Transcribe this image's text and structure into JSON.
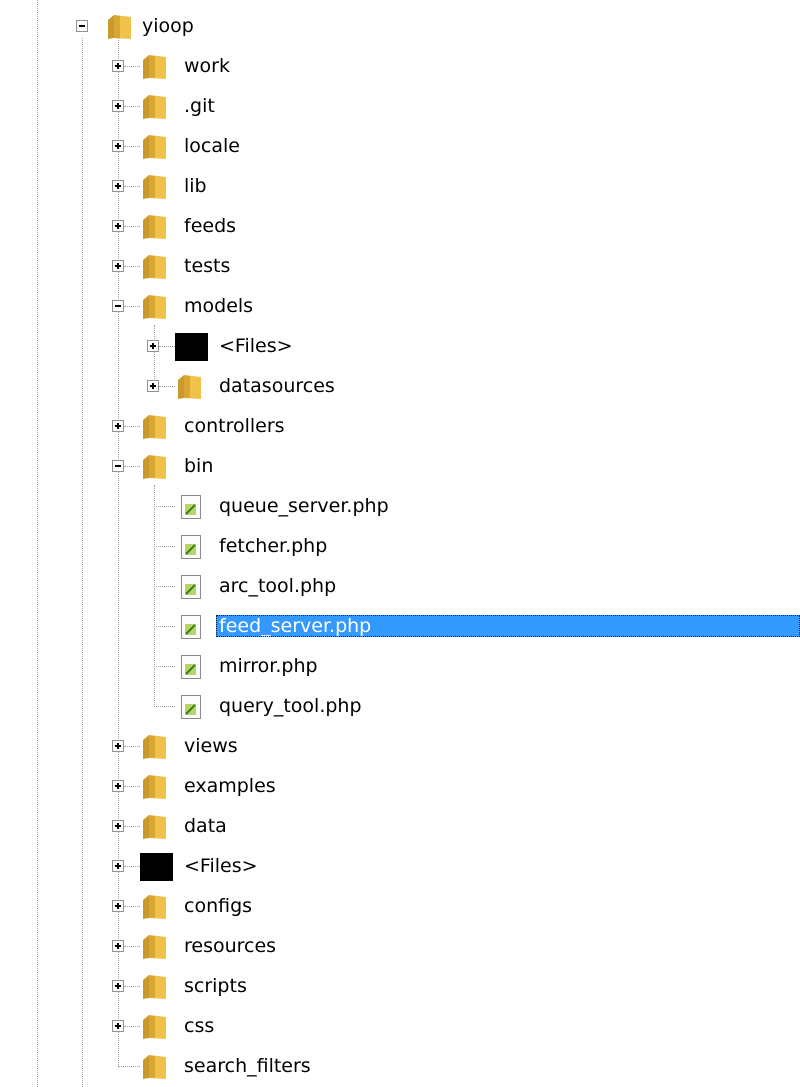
{
  "tree": {
    "root": {
      "label": "yioop",
      "expanded": true
    },
    "colors": {
      "selection": "#3399ff",
      "folder": "#e8b339"
    },
    "items": [
      {
        "label": "work",
        "type": "folder",
        "expander": "plus"
      },
      {
        "label": ".git",
        "type": "folder",
        "expander": "plus"
      },
      {
        "label": "locale",
        "type": "folder",
        "expander": "plus"
      },
      {
        "label": "lib",
        "type": "folder",
        "expander": "plus"
      },
      {
        "label": "feeds",
        "type": "folder",
        "expander": "plus"
      },
      {
        "label": "tests",
        "type": "folder",
        "expander": "plus"
      },
      {
        "label": "models",
        "type": "folder",
        "expander": "minus",
        "children": [
          {
            "label": "<Files>",
            "type": "files-group",
            "expander": "plus"
          },
          {
            "label": "datasources",
            "type": "folder",
            "expander": "plus"
          }
        ]
      },
      {
        "label": "controllers",
        "type": "folder",
        "expander": "plus"
      },
      {
        "label": "bin",
        "type": "folder",
        "expander": "minus",
        "children": [
          {
            "label": "queue_server.php",
            "type": "file"
          },
          {
            "label": "fetcher.php",
            "type": "file"
          },
          {
            "label": "arc_tool.php",
            "type": "file"
          },
          {
            "label": "feed_server.php",
            "type": "file",
            "selected": true
          },
          {
            "label": "mirror.php",
            "type": "file"
          },
          {
            "label": "query_tool.php",
            "type": "file"
          }
        ]
      },
      {
        "label": "views",
        "type": "folder",
        "expander": "plus"
      },
      {
        "label": "examples",
        "type": "folder",
        "expander": "plus"
      },
      {
        "label": "data",
        "type": "folder",
        "expander": "plus"
      },
      {
        "label": "<Files>",
        "type": "files-group",
        "expander": "plus"
      },
      {
        "label": "configs",
        "type": "folder",
        "expander": "plus"
      },
      {
        "label": "resources",
        "type": "folder",
        "expander": "plus"
      },
      {
        "label": "scripts",
        "type": "folder",
        "expander": "plus"
      },
      {
        "label": "css",
        "type": "folder",
        "expander": "plus"
      },
      {
        "label": "search_filters",
        "type": "folder",
        "expander": "none"
      }
    ]
  }
}
